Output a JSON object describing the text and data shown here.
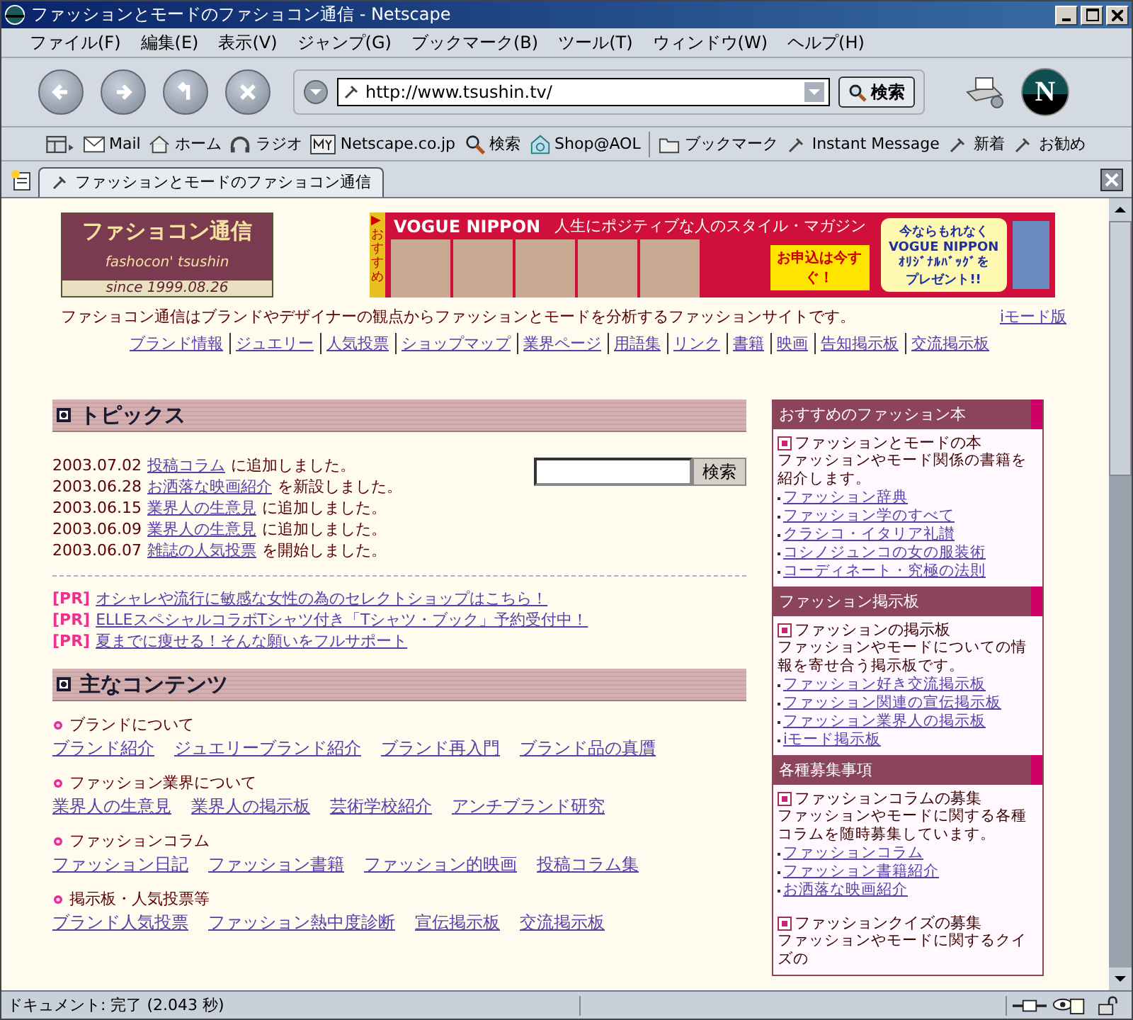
{
  "window": {
    "title": "ファッションとモードのファショコン通信 - Netscape",
    "logo_mark": "N",
    "menu": [
      "ファイル(F)",
      "編集(E)",
      "表示(V)",
      "ジャンプ(G)",
      "ブックマーク(B)",
      "ツール(T)",
      "ウィンドウ(W)",
      "ヘルプ(H)"
    ],
    "url": "http://www.tsushin.tv/",
    "search_button": "検索",
    "personal_toolbar": [
      {
        "label": "Mail",
        "kind": "mail"
      },
      {
        "label": "ホーム",
        "kind": "home"
      },
      {
        "label": "ラジオ",
        "kind": "radio"
      },
      {
        "label": "Netscape.co.jp",
        "kind": "my"
      },
      {
        "label": "検索",
        "kind": "search"
      },
      {
        "label": "Shop@AOL",
        "kind": "shop"
      },
      {
        "label": "ブックマーク",
        "kind": "folder"
      },
      {
        "label": "Instant Message",
        "kind": "bookmark"
      },
      {
        "label": "新着",
        "kind": "bookmark"
      },
      {
        "label": "お勧め",
        "kind": "bookmark"
      }
    ],
    "tab_title": "ファッションとモードのファショコン通信"
  },
  "page": {
    "logo": {
      "title": "ファショコン通信",
      "subtitle": "fashocon' tsushin",
      "since": "since 1999.08.26"
    },
    "banner": {
      "tag": "▶おすすめ",
      "brand": "VOGUE NIPPON",
      "slogan": "人生にポジティブな人のスタイル・マガジン",
      "burst": "お申込は今すぐ！",
      "offer": [
        "今ならもれなく",
        "VOGUE NIPPON",
        "ｵﾘｼﾞﾅﾙﾊﾞｯｸﾞを",
        "プレゼント!!"
      ]
    },
    "tagline": "ファショコン通信はブランドやデザイナーの観点からファッションとモードを分析するファッションサイトです。",
    "imode_link": "iモード版",
    "nav_links": [
      "ブランド情報",
      "ジュエリー",
      "人気投票",
      "ショップマップ",
      "業界ページ",
      "用語集",
      "リンク",
      "書籍",
      "映画",
      "告知掲示板",
      "交流掲示板"
    ],
    "topics": {
      "heading": "トピックス",
      "search_button": "検索",
      "items": [
        {
          "date": "2003.07.02",
          "link": "投稿コラム",
          "rest": "に追加しました。"
        },
        {
          "date": "2003.06.28",
          "link": "お洒落な映画紹介",
          "rest": "を新設しました。"
        },
        {
          "date": "2003.06.15",
          "link": "業界人の生意見",
          "rest": "に追加しました。"
        },
        {
          "date": "2003.06.09",
          "link": "業界人の生意見",
          "rest": "に追加しました。"
        },
        {
          "date": "2003.06.07",
          "link": "雑誌の人気投票",
          "rest": "を開始しました。"
        }
      ]
    },
    "pr": [
      {
        "tag": "[PR]",
        "text": "オシャレや流行に敏感な女性の為のセレクトショップはこちら！"
      },
      {
        "tag": "[PR]",
        "text": "ELLEスペシャルコラボTシャツ付き「Tシャツ・ブック」予約受付中！"
      },
      {
        "tag": "[PR]",
        "text": "夏までに痩せる！そんな願いをフルサポート"
      }
    ],
    "contents": {
      "heading": "主なコンテンツ",
      "groups": [
        {
          "title": "ブランドについて",
          "links": [
            "ブランド紹介",
            "ジュエリーブランド紹介",
            "ブランド再入門",
            "ブランド品の真贋"
          ]
        },
        {
          "title": "ファッション業界について",
          "links": [
            "業界人の生意見",
            "業界人の掲示板",
            "芸術学校紹介",
            "アンチブランド研究"
          ]
        },
        {
          "title": "ファッションコラム",
          "links": [
            "ファッション日記",
            "ファッション書籍",
            "ファッション的映画",
            "投稿コラム集"
          ]
        },
        {
          "title": "掲示板・人気投票等",
          "links": [
            "ブランド人気投票",
            "ファッション熱中度診断",
            "宣伝掲示板",
            "交流掲示板"
          ]
        }
      ]
    },
    "sidebar": [
      {
        "heading": "おすすめのファッション本",
        "blocks": [
          {
            "title": "ファッションとモードの本",
            "description": "ファッションやモード関係の書籍を紹介します。",
            "links": [
              "ファッション辞典",
              "ファッション学のすべて",
              "クラシコ・イタリア礼讃",
              "コシノジュンコの女の服装術",
              "コーディネート・究極の法則"
            ]
          }
        ]
      },
      {
        "heading": "ファッション掲示板",
        "blocks": [
          {
            "title": "ファッションの掲示板",
            "description": "ファッションやモードについての情報を寄せ合う掲示板です。",
            "links": [
              "ファッション好き交流掲示板",
              "ファッション関連の宣伝掲示板",
              "ファッション業界人の掲示板",
              "iモード掲示板"
            ]
          }
        ]
      },
      {
        "heading": "各種募集事項",
        "blocks": [
          {
            "title": "ファッションコラムの募集",
            "description": "ファッションやモードに関する各種コラムを随時募集しています。",
            "links": [
              "ファッションコラム",
              "ファッション書籍紹介",
              "お洒落な映画紹介"
            ]
          },
          {
            "title": "ファッションクイズの募集",
            "description": "ファッションやモードに関するクイズの"
          }
        ]
      }
    ]
  },
  "status_bar": "ドキュメント: 完了 (2.043 秒)"
}
